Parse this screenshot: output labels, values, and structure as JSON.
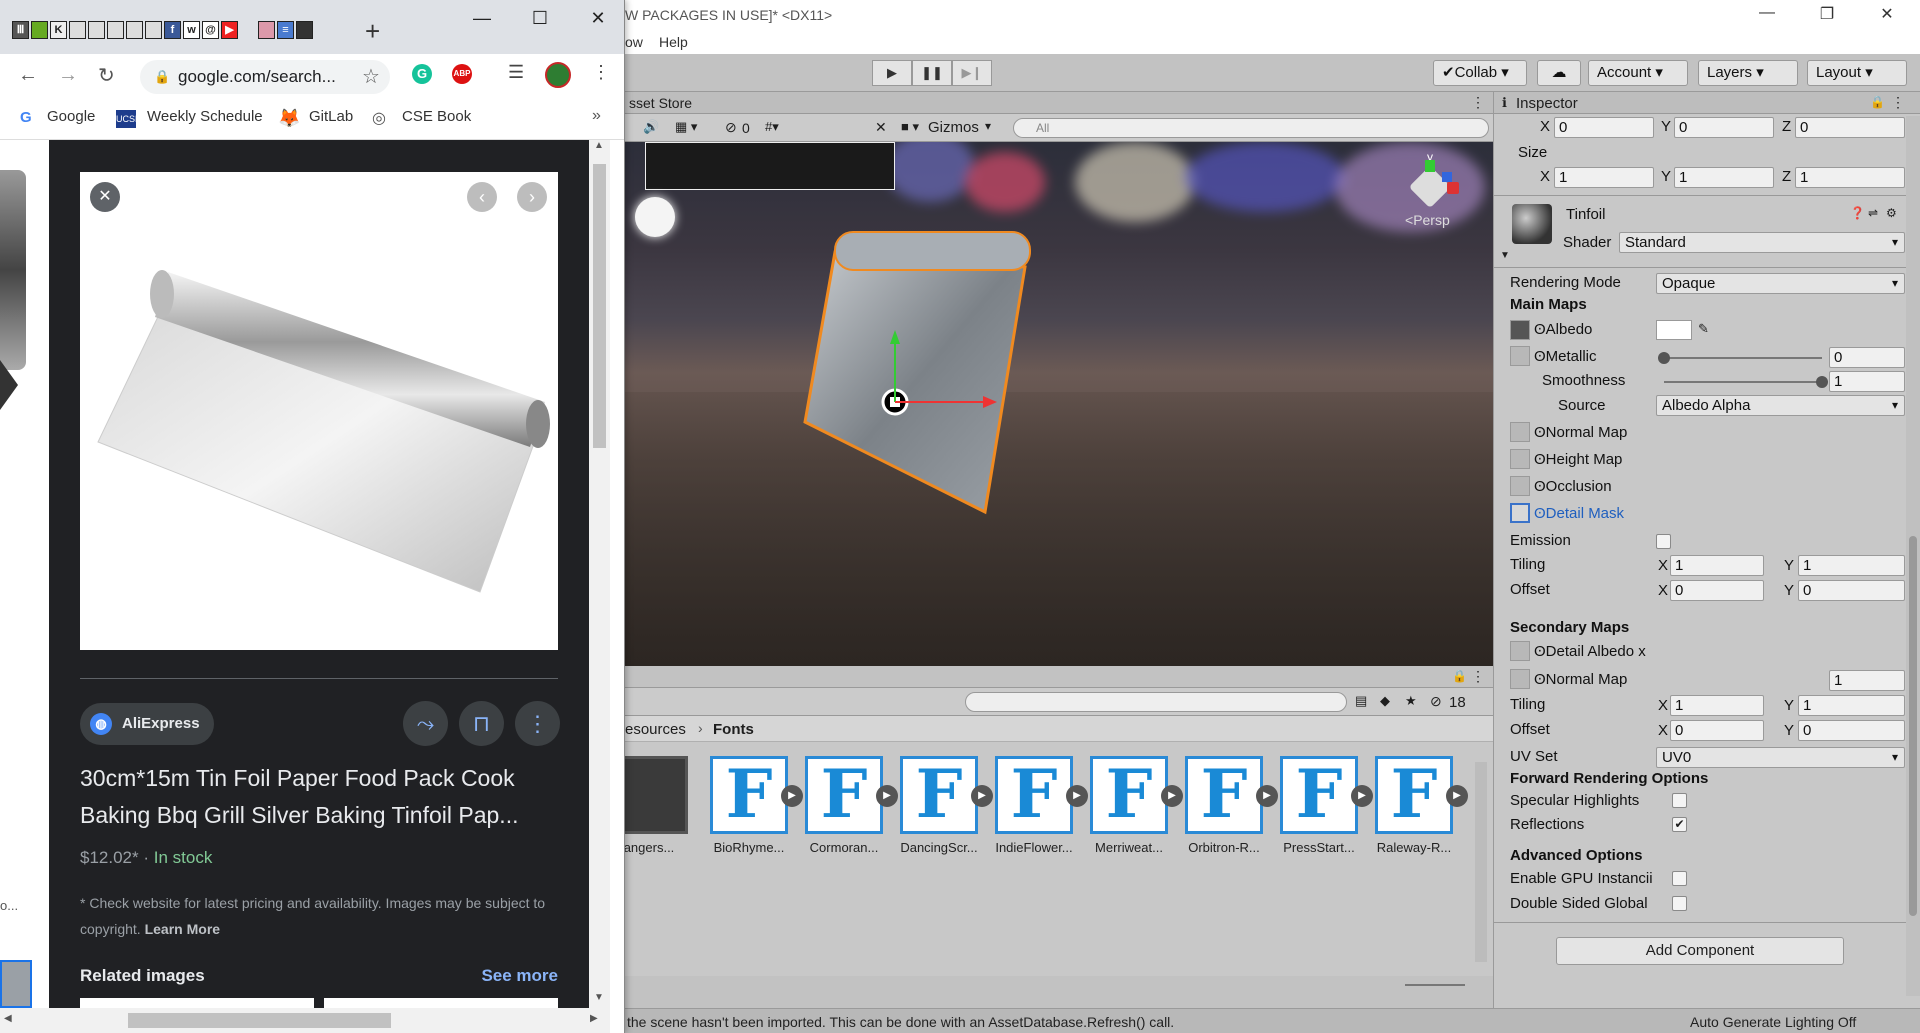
{
  "unity": {
    "title": "W PACKAGES IN USE]* <DX11>",
    "menus": [
      "ow",
      "Help"
    ],
    "toolbar": {
      "collab": "Collab",
      "account": "Account",
      "layers": "Layers",
      "layout": "Layout"
    },
    "scene": {
      "tab": "sset Store",
      "hidden_count": "0",
      "gizmos": "Gizmos",
      "search_placeholder": "All",
      "persp": "Persp"
    },
    "project": {
      "hidden_count": "18",
      "path": [
        "esources",
        "Fonts"
      ],
      "assets": [
        "angers...",
        "BioRhyme...",
        "Cormoran...",
        "DancingScr...",
        "IndieFlower...",
        "Merriweat...",
        "Orbitron-R...",
        "PressStart...",
        "Raleway-R..."
      ]
    },
    "status": {
      "message": "the scene hasn't been imported. This can be done with an AssetDatabase.Refresh() call.",
      "right": "Auto Generate Lighting Off"
    },
    "inspector": {
      "title": "Inspector",
      "top_xyz": {
        "x": "0",
        "y": "0",
        "z": "0"
      },
      "size_label": "Size",
      "size_xyz": {
        "x": "1",
        "y": "1",
        "z": "1"
      },
      "material_name": "Tinfoil",
      "shader_label": "Shader",
      "shader_value": "Standard",
      "rendering_mode_label": "Rendering Mode",
      "rendering_mode_value": "Opaque",
      "main_maps": "Main Maps",
      "albedo": "Albedo",
      "metallic": "Metallic",
      "metallic_value": "0",
      "metallic_level": 0.0,
      "smoothness": "Smoothness",
      "smoothness_value": "1",
      "smoothness_level": 1.0,
      "source_label": "Source",
      "source_value": "Albedo Alpha",
      "normal_map": "Normal Map",
      "height_map": "Height Map",
      "occlusion": "Occlusion",
      "detail_mask": "Detail Mask",
      "emission": "Emission",
      "tiling": "Tiling",
      "offset": "Offset",
      "tiling1": {
        "x": "1",
        "y": "1"
      },
      "offset1": {
        "x": "0",
        "y": "0"
      },
      "secondary_maps": "Secondary Maps",
      "detail_albedo": "Detail Albedo x",
      "normal_map2": "Normal Map",
      "normal_map2_value": "1",
      "tiling2": {
        "x": "1",
        "y": "1"
      },
      "offset2": {
        "x": "0",
        "y": "0"
      },
      "uv_set_label": "UV Set",
      "uv_set_value": "UV0",
      "forward_options": "Forward Rendering Options",
      "specular": "Specular Highlights",
      "reflections": "Reflections",
      "advanced": "Advanced Options",
      "gpu_instancing": "Enable GPU Instancii",
      "double_sided": "Double Sided Global",
      "add_component": "Add Component",
      "x": "X",
      "y": "Y",
      "z": "Z"
    }
  },
  "chrome": {
    "url": "google.com/search...",
    "bookmarks": [
      "Google",
      "Weekly Schedule",
      "GitLab",
      "CSE Book"
    ],
    "source_name": "AliExpress",
    "product_title": "30cm*15m Tin Foil Paper Food Pack Cook Baking Bbq Grill Silver Baking Tinfoil Pap...",
    "price": "$12.02*",
    "separator": "·",
    "stock": "In stock",
    "disclaimer": "* Check website for latest pricing and availability. Images may be subject to copyright.",
    "learn_more": "Learn More",
    "related": "Related images",
    "see_more": "See more",
    "left_edge_text": "o..."
  }
}
